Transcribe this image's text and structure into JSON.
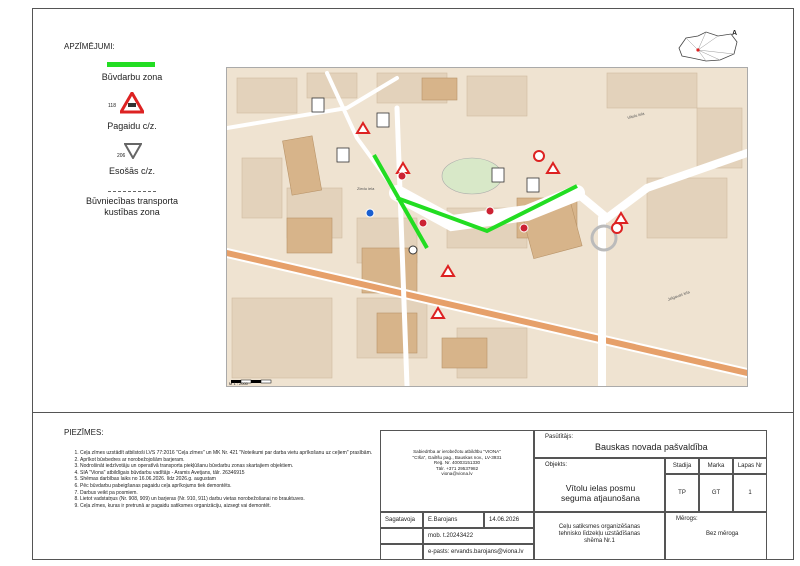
{
  "legend": {
    "title": "APZĪMĒJUMI:",
    "work_zone": "Būvdarbu zona",
    "sign1_number": "118",
    "sign1_label": "Pagaidu c/z.",
    "sign2_number": "206",
    "sign2_label": "Esošās c/z.",
    "transport_zone_line1": "Būvniecības transporta",
    "transport_zone_line2": "kustības zona",
    "work_zone_color": "#22dd22"
  },
  "map": {
    "scale_label": "M 1 : 2000",
    "streets": [
      "Ziedu iela",
      "Vītolu iela",
      "Jelgavas iela"
    ],
    "building_labels": [
      "Tilts",
      "Veikals",
      "Skola",
      "Māja",
      "Kafejnīca"
    ]
  },
  "notes": {
    "title": "PIEZĪMES:",
    "items": [
      "Ceļa zīmes uzstādīt atbilstoši LVS 77:2016 \"Ceļa zīmes\" un MK Nr. 421 \"Noteikumi par darba vietu aprīkošanu uz ceļiem\" prasībām.",
      "Aprīkot būvbedres ar norobežojošām barjeram.",
      "Nodrošināt iedzīvotāju un operatīvā transporta piekļūšanu būvdarbu zonas skartajiem objektiem.",
      "SIA \"Viona\" atbildīgais būvdarbu vadītājs - Aramis Avetjans, tālr. 26346915",
      "Shēmas darbības laiks no 16.06.2026. līdz 2026.g. augustam",
      "Pēc būvdarbu pabeigšanas pagaidu ceļa aprīkojums tiek demontēts.",
      "Darbus veikt pa posmiem.",
      "Lietot vadstatņus (Nr. 908, 909) un barjeras (Nr. 910, 911) darbu vietas norobežošanai no brauktuves.",
      "Ceļa zīmes, kuras ir pretrunā ar pagaidu satiksmes organizāciju, aizsegt vai demontēt."
    ]
  },
  "titleblock": {
    "company_line1": "Sabiedrība ar ierobežotu atbildību \"VIONA\"",
    "company_line2": "\"Cīša\", Gailīšu pag., Bauskas nov., LV-3931",
    "company_line3": "Reģ. Nr. 40003151330",
    "company_line4": "Tālr. +371 29537982",
    "company_line5": "viona@viona.lv",
    "client_label": "Pasūtītājs:",
    "client": "Bauskas novada pašvaldība",
    "object_label": "Objekts:",
    "object_line1": "Vītolu ielas posmu",
    "object_line2": "seguma atjaunošana",
    "stage_label": "Stadija",
    "stage": "TP",
    "mark_label": "Marka",
    "mark": "GT",
    "page_label": "Lapas Nr",
    "page": "1",
    "prepared_label": "Sagatavoja",
    "prepared_by": "E.Barojans",
    "date": "14.06.2026",
    "mobile": "mob. t.20243422",
    "email": "e-pasts: ervands.barojans@viona.lv",
    "drawing_line1": "Ceļu satiksmes organizēšanas",
    "drawing_line2": "tehnisko līdzekļu uzstādīšanas",
    "drawing_line3": "shēma Nr.1",
    "scale_label": "Mērogs:",
    "scale": "Bez mēroga"
  }
}
